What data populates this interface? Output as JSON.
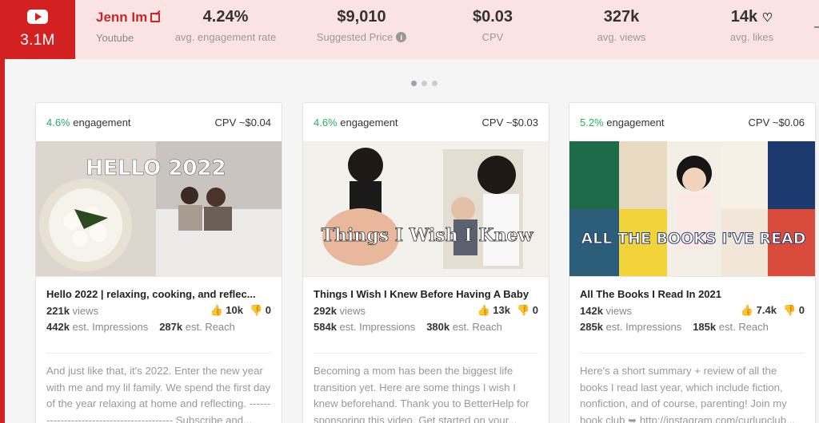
{
  "header": {
    "subscribers": "3.1M",
    "channel_name": "Jenn Im",
    "platform": "Youtube",
    "stats": [
      {
        "value": "4.24%",
        "label": "avg. engagement rate"
      },
      {
        "value": "$9,010",
        "label": "Suggested Price"
      },
      {
        "value": "$0.03",
        "label": "CPV"
      },
      {
        "value": "327k",
        "label": "avg. views"
      },
      {
        "value": "14k",
        "label": "avg. likes"
      }
    ]
  },
  "cards": [
    {
      "engagement_value": "4.6%",
      "engagement_label": "engagement",
      "cpv": "CPV ~$0.04",
      "thumb_text": "HELLO 2022",
      "title": "Hello 2022 | relaxing, cooking, and reflec...",
      "views_value": "221k",
      "views_label": "views",
      "likes": "10k",
      "dislikes": "0",
      "impressions_value": "442k",
      "impressions_label": "est. Impressions",
      "reach_value": "287k",
      "reach_label": "est. Reach",
      "description": "And just like that, it's 2022. Enter the new year with me and my lil family. We spend the first day of the year relaxing at home and reflecting. ------------------------------------------ Subscribe and..."
    },
    {
      "engagement_value": "4.6%",
      "engagement_label": "engagement",
      "cpv": "CPV ~$0.03",
      "thumb_text": "Things I Wish I Knew",
      "title": "Things I Wish I Knew Before Having A Baby",
      "views_value": "292k",
      "views_label": "views",
      "likes": "13k",
      "dislikes": "0",
      "impressions_value": "584k",
      "impressions_label": "est. Impressions",
      "reach_value": "380k",
      "reach_label": "est. Reach",
      "description": "Becoming a mom has been the biggest life transition yet. Here are some things I wish I knew beforehand. Thank you to BetterHelp for sponsoring this video. Get started on your..."
    },
    {
      "engagement_value": "5.2%",
      "engagement_label": "engagement",
      "cpv": "CPV ~$0.06",
      "thumb_text": "ALL THE BOOKS I'VE READ",
      "title": "All The Books I Read In 2021",
      "views_value": "142k",
      "views_label": "views",
      "likes": "7.4k",
      "dislikes": "0",
      "impressions_value": "285k",
      "impressions_label": "est. Impressions",
      "reach_value": "185k",
      "reach_label": "est. Reach",
      "description": "Here's a short summary + review of all the books I read last year, which include fiction, nonfiction, and of course, parenting! Join my book club ➥ http://instagram.com/curlupclub..."
    }
  ],
  "colors": {
    "accent": "#d32020",
    "header_bg": "#fbe3e4",
    "engagement": "#27ae60"
  }
}
